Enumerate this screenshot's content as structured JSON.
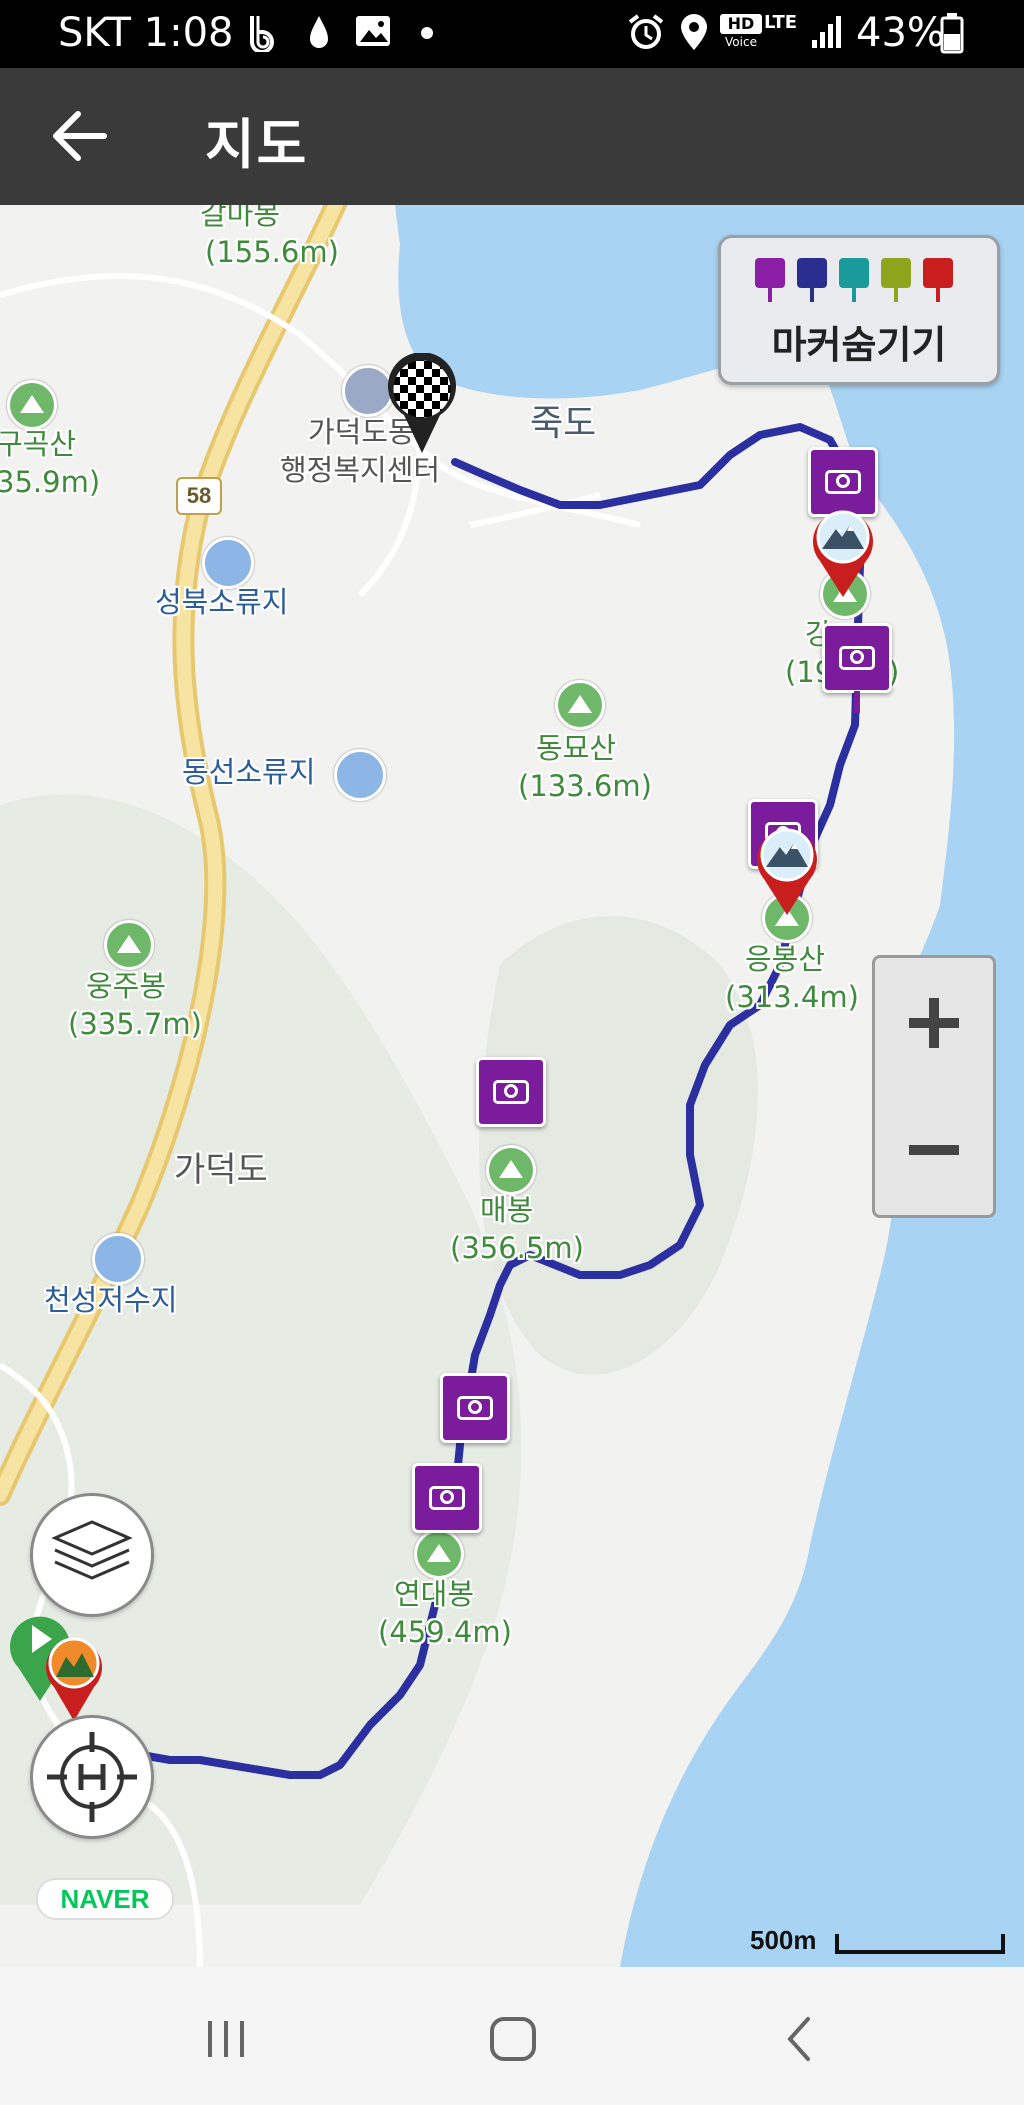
{
  "status_bar": {
    "carrier_time": "SKT 1:08",
    "lte": "LTE",
    "hd_voice": "HD Voice",
    "battery": "43%"
  },
  "app_bar": {
    "title": "지도",
    "back_icon": "arrow-left-icon"
  },
  "marker_panel": {
    "label": "마커숨기기",
    "icons": [
      "camera-icon",
      "video-icon",
      "mic-icon",
      "note-icon",
      "flag-icon"
    ],
    "colors": [
      "#8a1fa6",
      "#2a2f8f",
      "#1a9a9a",
      "#8fa51e",
      "#c81e1e"
    ]
  },
  "map": {
    "places": {
      "galmabong": "갈마봉",
      "galmabong_height": "(155.6m)",
      "gugoksan": "구곡산",
      "gugoksan_height": "35.9m)",
      "gadeok_office_1": "가덕도동",
      "gadeok_office_2": "행정복지센터",
      "jukdo": "죽도",
      "road_58": "58",
      "seongbuk_reservoir": "성북소류지",
      "ganggeum_1": "강",
      "ganggeum_2": "(19",
      "ganggeum_3": ")",
      "dongmyosan": "동묘산",
      "dongmyosan_height": "(133.6m)",
      "dongseon_reservoir": "동선소류지",
      "eungbongsan": "응봉산",
      "eungbongsan_height": "(313.4m)",
      "ungjubong": "웅주봉",
      "ungjubong_height": "(335.7m)",
      "gadeokdo": "가덕도",
      "maebong": "매봉",
      "maebong_height": "(356.5m)",
      "cheonseong_reservoir": "천성저수지",
      "yeondaebong": "연대봉",
      "yeondaebong_height": "(459.4m)"
    },
    "naver_logo": "NAVER",
    "scale": "500m"
  },
  "controls": {
    "zoom_in_icon": "plus-icon",
    "zoom_out_icon": "minus-icon",
    "layers_icon": "layers-icon",
    "locate_icon": "crosshair-h-icon"
  },
  "nav_bar": {
    "icons": [
      "recent-apps-icon",
      "home-icon",
      "back-icon"
    ]
  }
}
